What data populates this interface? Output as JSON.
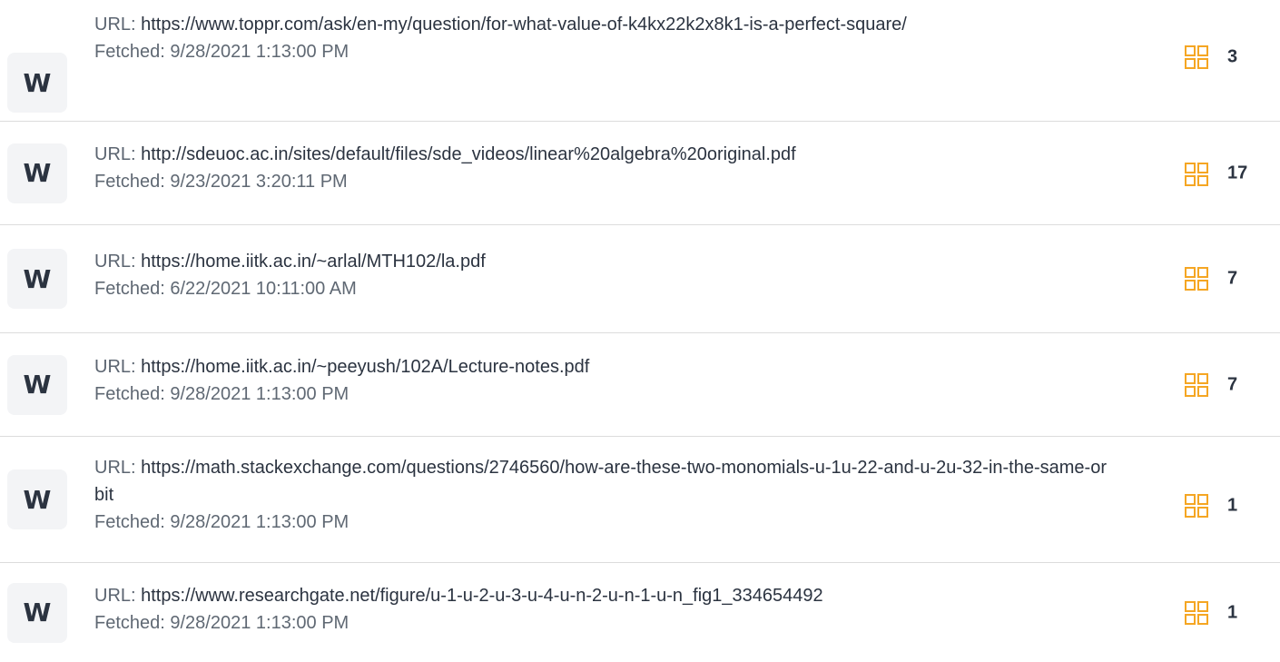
{
  "colors": {
    "accent": "#f5a623",
    "text": "#333a40",
    "divider": "#dcdcdc",
    "badge_bg": "#f3f4f6"
  },
  "sources": [
    {
      "badge": "W",
      "url_label": "URL: ",
      "url": "https://www.toppr.com/ask/en-my/question/for-what-value-of-k4kx22k2x8k1-is-a-perfect-square/",
      "fetched": "Fetched: 9/28/2021 1:13:00 PM",
      "icon": "grid-icon",
      "count": "3"
    },
    {
      "badge": "W",
      "url_label": "URL: ",
      "url": "http://sdeuoc.ac.in/sites/default/files/sde_videos/linear%20algebra%20original.pdf",
      "fetched": "Fetched: 9/23/2021 3:20:11 PM",
      "icon": "grid-icon",
      "count": "17"
    },
    {
      "badge": "W",
      "url_label": "URL: ",
      "url": "https://home.iitk.ac.in/~arlal/MTH102/la.pdf",
      "fetched": "Fetched: 6/22/2021 10:11:00 AM",
      "icon": "grid-icon",
      "count": "7"
    },
    {
      "badge": "W",
      "url_label": "URL: ",
      "url": "https://home.iitk.ac.in/~peeyush/102A/Lecture-notes.pdf",
      "fetched": "Fetched: 9/28/2021 1:13:00 PM",
      "icon": "grid-icon",
      "count": "7"
    },
    {
      "badge": "W",
      "url_label": "URL: ",
      "url": "https://math.stackexchange.com/questions/2746560/how-are-these-two-monomials-u-1u-22-and-u-2u-32-in-the-same-orbit",
      "fetched": "Fetched: 9/28/2021 1:13:00 PM",
      "icon": "grid-icon",
      "count": "1"
    },
    {
      "badge": "W",
      "url_label": "URL: ",
      "url": "https://www.researchgate.net/figure/u-1-u-2-u-3-u-4-u-n-2-u-n-1-u-n_fig1_334654492",
      "fetched": "Fetched: 9/28/2021 1:13:00 PM",
      "icon": "grid-icon",
      "count": "1"
    }
  ]
}
